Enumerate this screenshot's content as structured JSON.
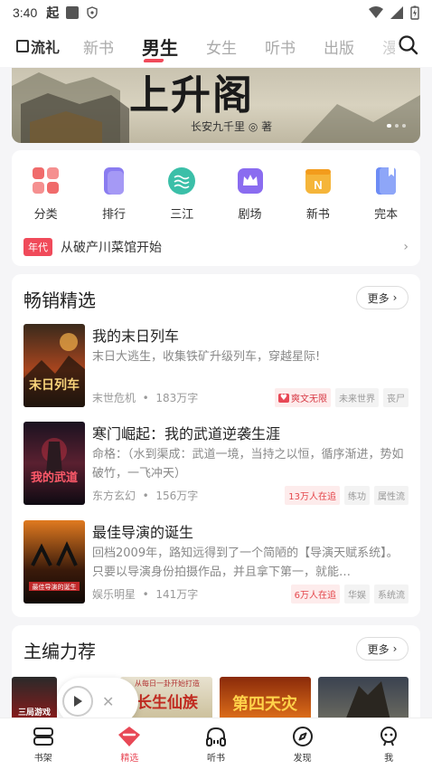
{
  "status": {
    "time": "3:40"
  },
  "topnav": {
    "logo": "流礼",
    "tabs": [
      {
        "label": "新书"
      },
      {
        "label": "男生"
      },
      {
        "label": "女生"
      },
      {
        "label": "听书"
      },
      {
        "label": "出版"
      },
      {
        "label": "漫"
      }
    ]
  },
  "banner": {
    "title": "上升阁",
    "author": "长安九千里 ◎ 著"
  },
  "categories": [
    {
      "label": "分类",
      "icon": "grid-icon",
      "color": "#f06b6b"
    },
    {
      "label": "排行",
      "icon": "rank-icon",
      "color": "#8a7cf0"
    },
    {
      "label": "三江",
      "icon": "wave-icon",
      "color": "#3bbfa8"
    },
    {
      "label": "剧场",
      "icon": "crown-icon",
      "color": "#8a6cf0"
    },
    {
      "label": "新书",
      "icon": "new-book-icon",
      "color": "#f5b53a"
    },
    {
      "label": "完本",
      "icon": "bookmark-icon",
      "color": "#6d8cf5"
    }
  ],
  "notice": {
    "tag": "年代",
    "text": "从破产川菜馆开始"
  },
  "bestsellers": {
    "title": "畅销精选",
    "more": "更多",
    "books": [
      {
        "title": "我的末日列车",
        "desc": "末日大逃生，收集铁矿升级列车，穿越星际!",
        "genre": "末世危机",
        "words": "183万字",
        "brand_tag": "爽文无限",
        "tags": [
          "未来世界",
          "丧尸"
        ]
      },
      {
        "title": "寒门崛起：我的武道逆袭生涯",
        "desc": "命格：（水到渠成：武道一境，当持之以恒，循序渐进，势如破竹，一飞冲天）",
        "genre": "东方玄幻",
        "words": "156万字",
        "red_tag": "13万人在追",
        "tags": [
          "练功",
          "属性流"
        ]
      },
      {
        "title": "最佳导演的诞生",
        "desc": "回档2009年，路知远得到了一个简陋的【导演天赋系统】。只要以导演身份拍摄作品，并且拿下第一，就能…",
        "genre": "娱乐明星",
        "words": "141万字",
        "red_tag": "6万人在追",
        "tags": [
          "华娱",
          "系统流"
        ]
      }
    ]
  },
  "editor": {
    "title": "主编力荐",
    "more": "更多",
    "cover_texts": [
      "三局游戏",
      "长生仙族",
      "第四天灾"
    ],
    "cover_caption": "从每日一卦开始打造"
  },
  "bottom_nav": [
    {
      "label": "书架",
      "icon": "bookshelf-icon"
    },
    {
      "label": "精选",
      "icon": "featured-icon"
    },
    {
      "label": "听书",
      "icon": "headphones-icon"
    },
    {
      "label": "发现",
      "icon": "compass-icon"
    },
    {
      "label": "我",
      "icon": "profile-icon"
    }
  ],
  "colors": {
    "accent": "#f04a5a"
  }
}
